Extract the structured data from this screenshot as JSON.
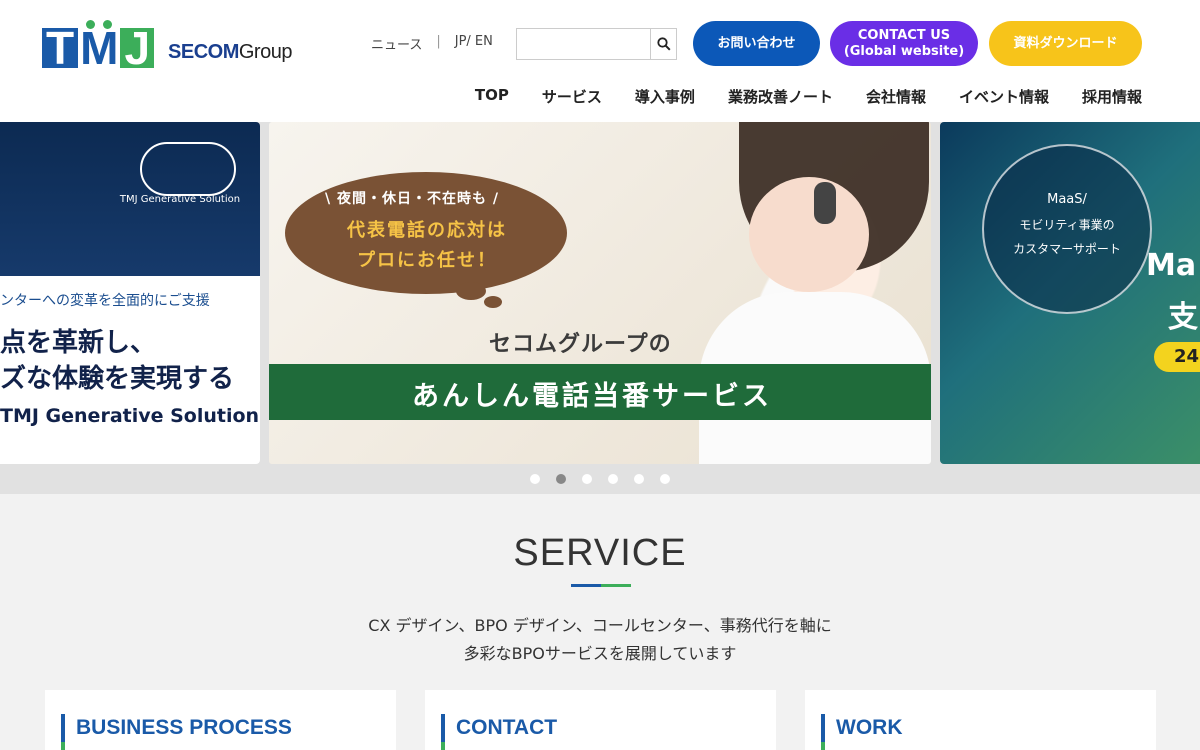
{
  "header": {
    "logo_text": "TMJ",
    "group_brand": "SECOM",
    "group_suffix": "Group",
    "util_news": "ニュース",
    "util_sep": "|",
    "util_lang": "JP/ EN",
    "search_placeholder": "",
    "btn_inquiry": "お問い合わせ",
    "btn_contact_line1": "CONTACT US",
    "btn_contact_line2": "(Global website)",
    "btn_download": "資料ダウンロード",
    "colors": {
      "blue": "#0c58b8",
      "purple": "#6a2ee6",
      "yellow": "#f7c41a"
    }
  },
  "nav": [
    {
      "label": "TOP"
    },
    {
      "label": "サービス"
    },
    {
      "label": "導入事例"
    },
    {
      "label": "業務改善ノート"
    },
    {
      "label": "会社情報"
    },
    {
      "label": "イベント情報"
    },
    {
      "label": "採用情報"
    }
  ],
  "carousel": {
    "left_slide": {
      "badge": "TMJ Generative Solution",
      "line1": "ンターへの変革を全面的にご支援",
      "line2": "点を革新し、",
      "line3": "ズな体験を実現する",
      "line4": "TMJ Generative Solution"
    },
    "center_slide": {
      "bubble_top": "\\ 夜間・休日・不在時も /",
      "bubble_mid": "代表電話の応対は",
      "bubble_bot": "プロにお任せ！",
      "sub": "セコムグループの",
      "band": "あんしん電話当番サービス"
    },
    "right_slide": {
      "circle_t1": "MaaS/",
      "circle_t2": "モビリティ事業の",
      "circle_t3": "カスタマーサポート",
      "big1": "Ma",
      "big2": "支",
      "yellow": "24"
    },
    "dots_count": 6,
    "active_dot": 2
  },
  "service": {
    "title": "SERVICE",
    "desc_line1": "CX デザイン、BPO デザイン、コールセンター、事務代行を軸に",
    "desc_line2": "多彩なBPOサービスを展開しています",
    "cards": [
      {
        "label": "BUSINESS PROCESS"
      },
      {
        "label": "CONTACT"
      },
      {
        "label": "WORK"
      }
    ]
  }
}
